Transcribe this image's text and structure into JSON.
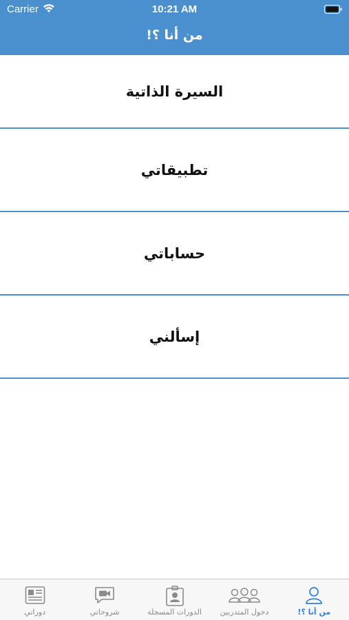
{
  "status_bar": {
    "carrier": "Carrier",
    "time": "10:21 AM",
    "icons": [
      "wifi-icon",
      "battery-icon"
    ]
  },
  "nav": {
    "title": "من أنا ؟!"
  },
  "menu": {
    "items": [
      {
        "label": "السيرة الذاتية"
      },
      {
        "label": "تطبيقاتي"
      },
      {
        "label": "حساباتي"
      },
      {
        "label": "إسألني"
      }
    ]
  },
  "tab_bar": {
    "tabs": [
      {
        "label": "دوراتي",
        "icon": "newspaper-icon"
      },
      {
        "label": "شروحاتي",
        "icon": "video-chat-icon"
      },
      {
        "label": "الدورات المسجلة",
        "icon": "id-badge-icon"
      },
      {
        "label": "دخول المتدربين",
        "icon": "group-icon"
      },
      {
        "label": "من أنا ؟!",
        "icon": "person-icon",
        "active": true
      }
    ]
  },
  "colors": {
    "brand": "#4a90cf",
    "active_tab": "#2d7fe0",
    "inactive_tab": "#8a8a8a"
  }
}
